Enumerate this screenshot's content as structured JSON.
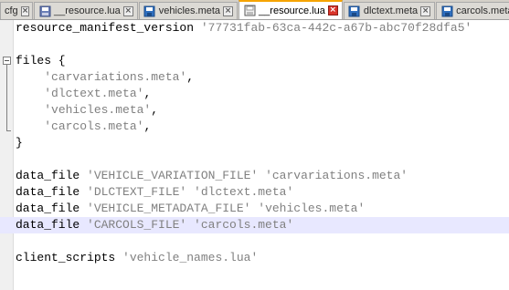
{
  "tabs": [
    {
      "label": "cfg",
      "icon": "",
      "active": false
    },
    {
      "label": "__resource.lua",
      "icon": "file-icon",
      "active": false
    },
    {
      "label": "vehicles.meta",
      "icon": "save-icon",
      "active": false
    },
    {
      "label": "__resource.lua",
      "icon": "file-icon",
      "active": true
    },
    {
      "label": "dlctext.meta",
      "icon": "save-icon",
      "active": false
    },
    {
      "label": "carcols.meta",
      "icon": "save-icon",
      "active": false
    }
  ],
  "colors": {
    "accent": "#f6a400",
    "string": "#808080",
    "current_line": "#e8e8ff",
    "close_active": "#d9342b"
  },
  "code": {
    "l1_key": "resource_manifest_version ",
    "l1_val": "'77731fab-63ca-442c-a67b-abc70f28dfa5'",
    "l3": "files {",
    "l4_val": "'carvariations.meta'",
    "l5_val": "'dlctext.meta'",
    "l6_val": "'vehicles.meta'",
    "l7_val": "'carcols.meta'",
    "comma": ",",
    "l8": "}",
    "df": "data_file ",
    "l10_a": "'VEHICLE_VARIATION_FILE'",
    "l10_b": "'carvariations.meta'",
    "l11_a": "'DLCTEXT_FILE'",
    "l11_b": "'dlctext.meta'",
    "l12_a": "'VEHICLE_METADATA_FILE'",
    "l12_b": "'vehicles.meta'",
    "l13_a": "'CARCOLS_FILE'",
    "l13_b": "'carcols.meta'",
    "l15_key": "client_scripts ",
    "l15_val": "'vehicle_names.lua'"
  }
}
